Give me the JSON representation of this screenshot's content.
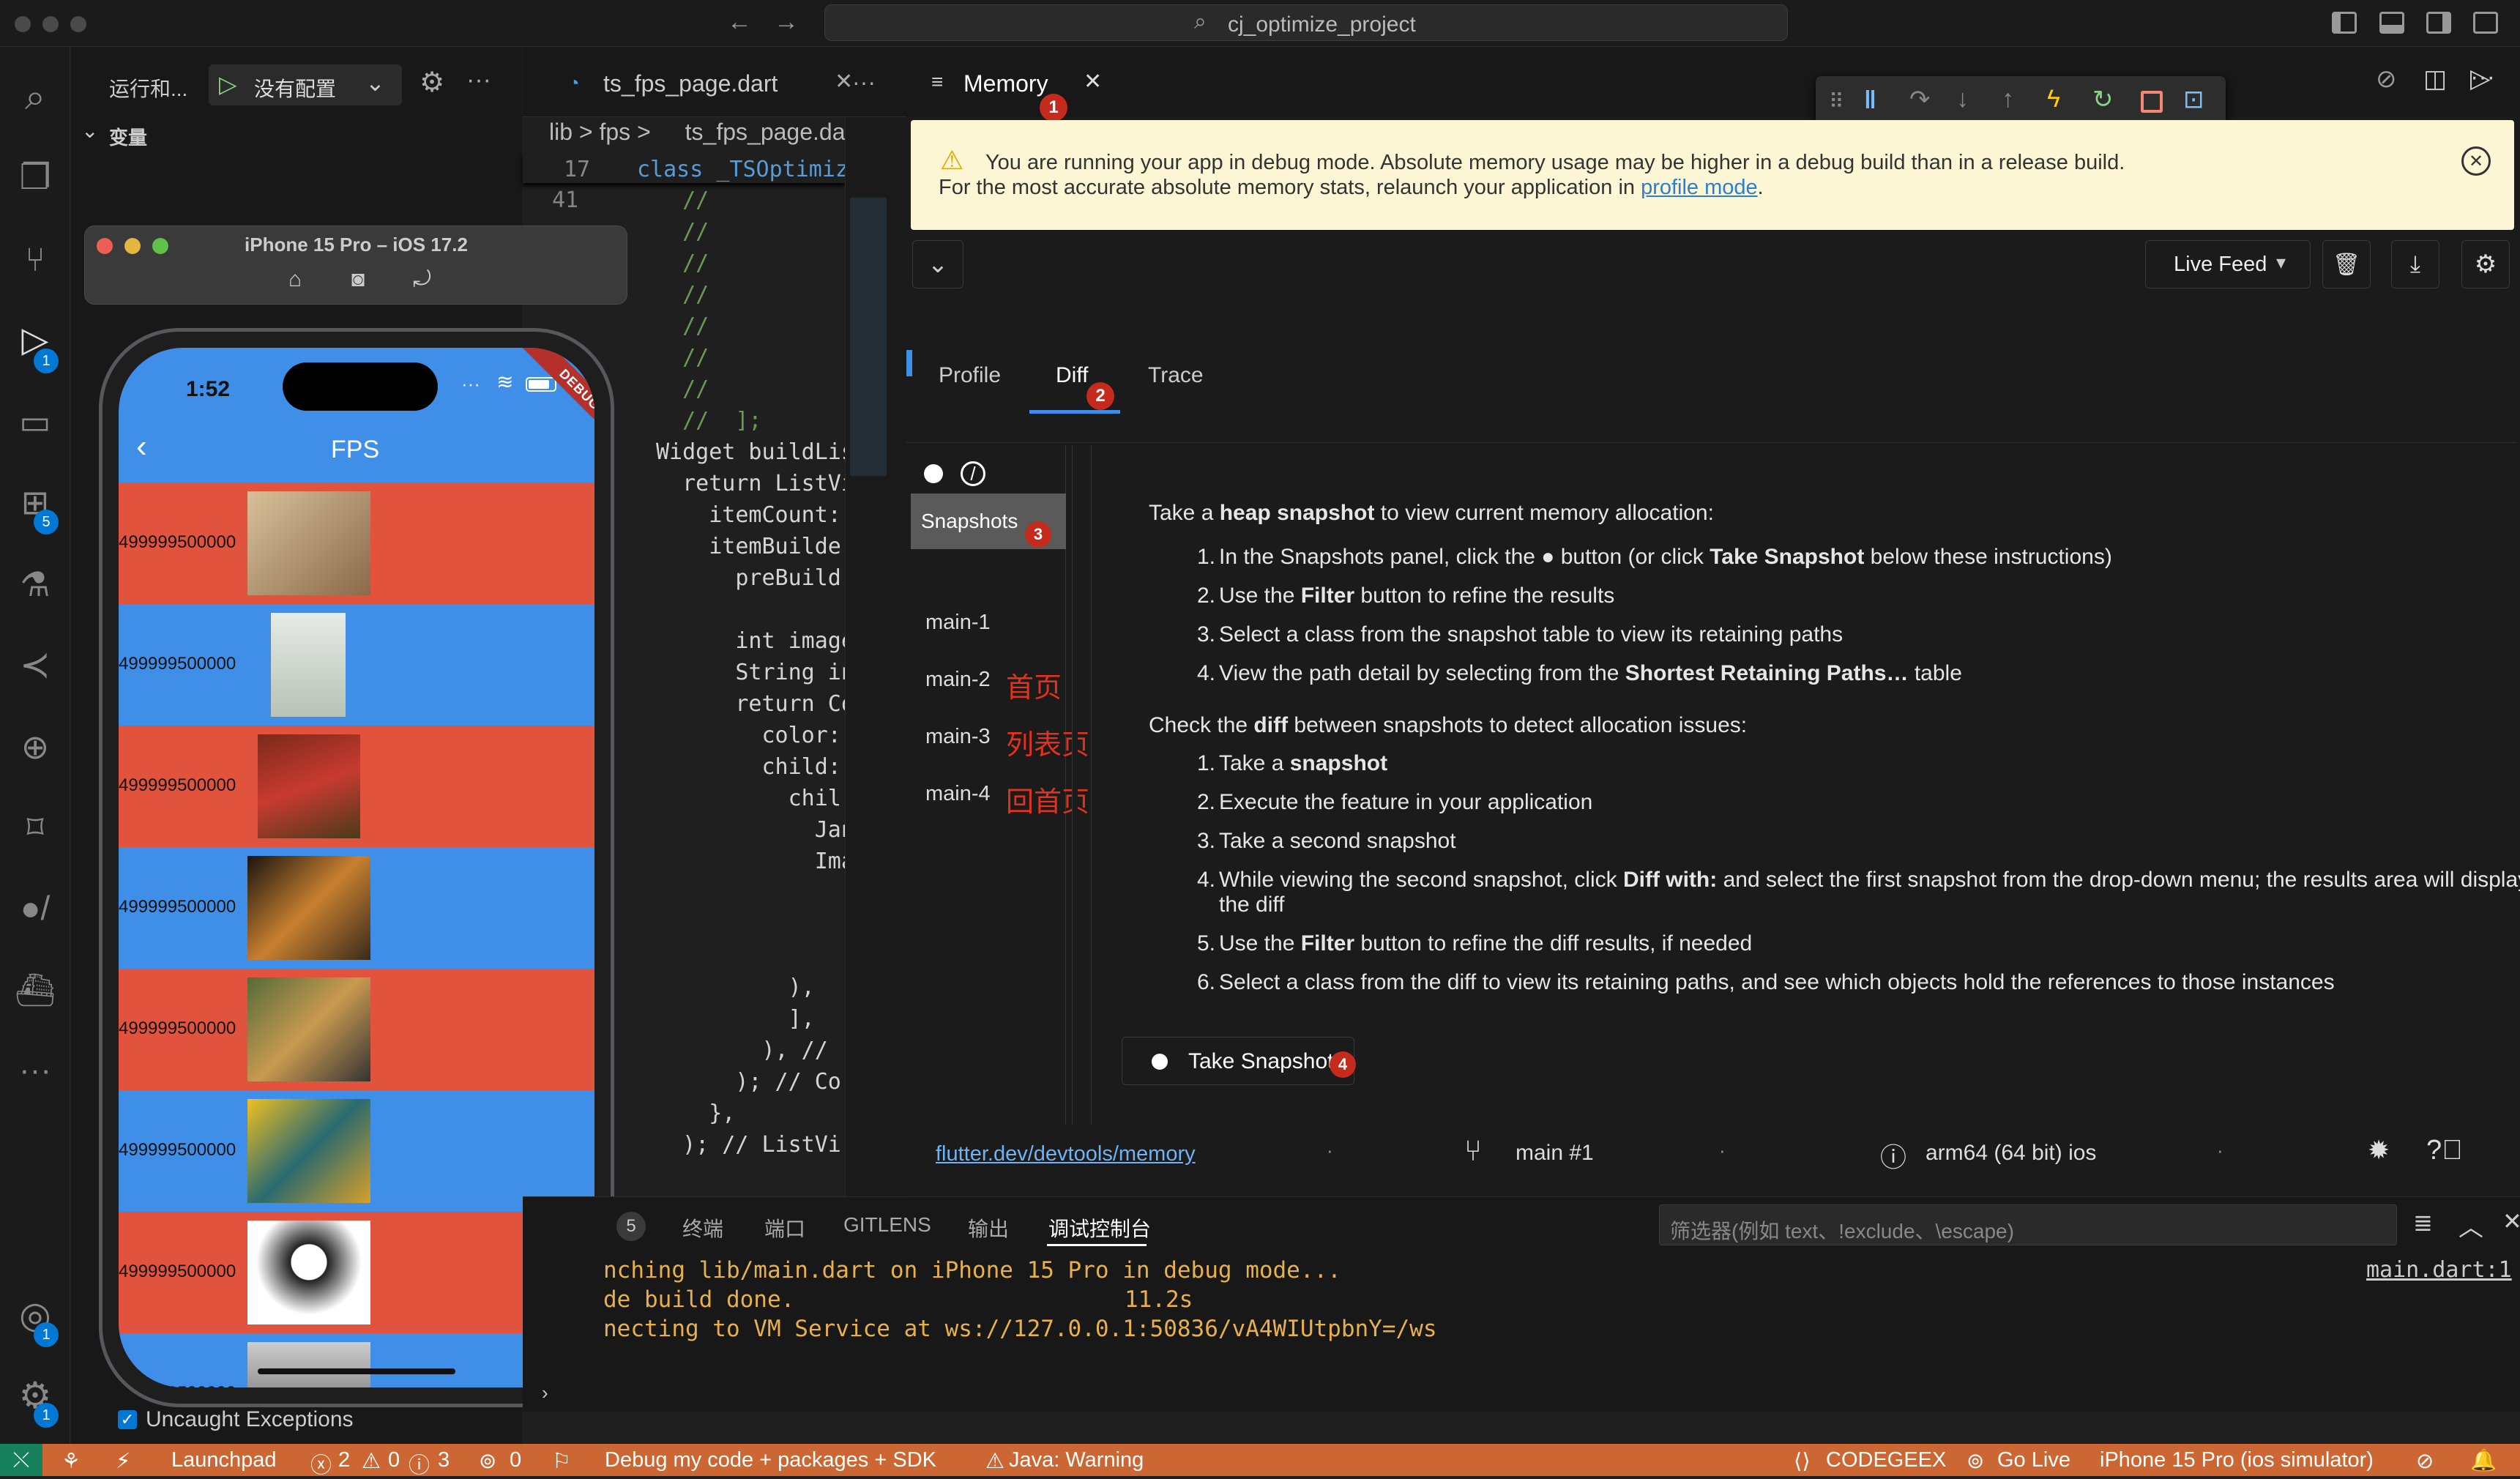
{
  "titlebar": {
    "search": "cj_optimize_project"
  },
  "activity_badges": {
    "run": "1",
    "extensions": "5",
    "accounts": "1",
    "settings": "1"
  },
  "left_panel": {
    "run_label": "运行和...",
    "config": "没有配置",
    "variables": "变量",
    "uncaught": "Uncaught Exceptions"
  },
  "simulator": {
    "title": "iPhone 15 Pro – iOS 17.2",
    "time": "1:52",
    "app_title": "FPS",
    "debug_ribbon": "DEBUG",
    "row_text": "499999500000"
  },
  "editor": {
    "tab": "ts_fps_page.dart",
    "breadcrumb": [
      "lib",
      ">",
      "fps",
      ">",
      "ts_fps_page.dart"
    ],
    "sticky_num": "17",
    "sticky_code": "class _TSOptimize",
    "lines": [
      {
        "n": "41",
        "c": "  //"
      },
      {
        "n": "",
        "c": "  //"
      },
      {
        "n": "",
        "c": "  //"
      },
      {
        "n": "",
        "c": "  //"
      },
      {
        "n": "",
        "c": "  //"
      },
      {
        "n": "",
        "c": "  //"
      },
      {
        "n": "",
        "c": "  //"
      },
      {
        "n": "",
        "c": "  //  ];"
      },
      {
        "n": "",
        "c": "Widget buildLis"
      },
      {
        "n": "",
        "c": "  return ListVi"
      },
      {
        "n": "",
        "c": "    itemCount:"
      },
      {
        "n": "",
        "c": "    itemBuilde"
      },
      {
        "n": "",
        "c": "      preBuild"
      },
      {
        "n": "",
        "c": ""
      },
      {
        "n": "",
        "c": "      int image"
      },
      {
        "n": "",
        "c": "      String in"
      },
      {
        "n": "",
        "c": "      return Co"
      },
      {
        "n": "",
        "c": "        color:"
      },
      {
        "n": "",
        "c": "        child:"
      },
      {
        "n": "",
        "c": "          chil"
      },
      {
        "n": "",
        "c": "            Jan"
      },
      {
        "n": "",
        "c": "            Ima"
      },
      {
        "n": "",
        "c": ""
      },
      {
        "n": "",
        "c": ""
      },
      {
        "n": "",
        "c": ""
      },
      {
        "n": "",
        "c": "          ),"
      },
      {
        "n": "",
        "c": "          ],"
      },
      {
        "n": "",
        "c": "        ), //"
      },
      {
        "n": "",
        "c": "      ); // Co"
      },
      {
        "n": "",
        "c": "    },"
      },
      {
        "n": "",
        "c": "  ); // ListVi"
      }
    ]
  },
  "memory": {
    "tab": "Memory",
    "warning_line1": "You are running your app in debug mode. Absolute memory usage may be higher in a debug build than in a release build.",
    "warning_line2": "For the most accurate absolute memory stats, relaunch your application in ",
    "profile_link": "profile mode",
    "period": ".",
    "live_feed": "Live Feed",
    "tabs": [
      "Profile",
      "Diff",
      "Trace"
    ],
    "snapshots": [
      "Snapshots",
      "main-1",
      "main-2",
      "main-3",
      "main-4"
    ],
    "annotations": [
      "首页",
      "列表页",
      "回首页"
    ],
    "markers": [
      "1",
      "2",
      "3",
      "4"
    ],
    "intro": {
      "a": "Take a ",
      "b": "heap snapshot",
      "c": " to view current memory allocation:"
    },
    "steps1": [
      {
        "n": "1.",
        "parts": [
          [
            "In the Snapshots panel, click the ",
            0
          ],
          [
            "●",
            0
          ],
          [
            " button (or click ",
            0
          ],
          [
            "Take Snapshot",
            1
          ],
          [
            " below these instructions)",
            0
          ]
        ]
      },
      {
        "n": "2.",
        "parts": [
          [
            "Use the ",
            0
          ],
          [
            "Filter",
            1
          ],
          [
            " button to refine the results",
            0
          ]
        ]
      },
      {
        "n": "3.",
        "parts": [
          [
            "Select a class from the snapshot table to view its retaining paths",
            0
          ]
        ]
      },
      {
        "n": "4.",
        "parts": [
          [
            "View the path detail by selecting from the ",
            0
          ],
          [
            "Shortest Retaining Paths…",
            1
          ],
          [
            " table",
            0
          ]
        ]
      }
    ],
    "diff_intro": {
      "a": "Check the ",
      "b": "diff",
      "c": " between snapshots to detect allocation issues:"
    },
    "steps2": [
      {
        "n": "1.",
        "parts": [
          [
            "Take a ",
            0
          ],
          [
            "snapshot",
            1
          ]
        ]
      },
      {
        "n": "2.",
        "parts": [
          [
            "Execute the feature in your application",
            0
          ]
        ]
      },
      {
        "n": "3.",
        "parts": [
          [
            "Take a second snapshot",
            0
          ]
        ]
      },
      {
        "n": "4.",
        "parts": [
          [
            "While viewing the second snapshot, click ",
            0
          ],
          [
            "Diff with:",
            1
          ],
          [
            " and select the first snapshot from the drop-down menu; the results area will display",
            0
          ]
        ],
        "cont": "the diff"
      },
      {
        "n": "5.",
        "parts": [
          [
            "Use the ",
            0
          ],
          [
            "Filter",
            1
          ],
          [
            " button to refine the diff results, if needed",
            0
          ]
        ]
      },
      {
        "n": "6.",
        "parts": [
          [
            "Select a class from the diff to view its retaining paths, and see which objects hold the references to those instances",
            0
          ]
        ]
      }
    ],
    "take_snapshot": "Take Snapshot",
    "footer": {
      "link": "flutter.dev/devtools/memory",
      "isolate": "main #1",
      "arch": "arm64 (64 bit) ios"
    }
  },
  "panel": {
    "tabs": [
      "5",
      "终端",
      "端口",
      "GITLENS",
      "输出",
      "调试控制台"
    ],
    "filter_placeholder": "筛选器(例如 text、!exclude、\\escape)",
    "lines": [
      {
        "a": "nching lib/main.dart on iPhone 15 Pro in debug mode...",
        "b": ""
      },
      {
        "a": "de build done.",
        "b": "11.2s"
      },
      {
        "a": "necting to VM Service at ws://127.0.0.1:50836/vA4WIUtpbnY=/ws",
        "b": ""
      }
    ],
    "source": "main.dart:1"
  },
  "statusbar": {
    "launchpad": "Launchpad",
    "errors": "2",
    "warnings": "0",
    "infos": "3",
    "ports": "0",
    "debug": "Debug my code + packages + SDK",
    "java": "Java: Warning",
    "codegeex": "CODEGEEX",
    "golive": "Go Live",
    "device": "iPhone 15 Pro (ios simulator)"
  },
  "colors": {
    "accent": "#0078d4",
    "status": "#cc6633",
    "warn_bg": "#fdf6d4",
    "red": "#e2533e",
    "blue": "#3f8ee8"
  }
}
